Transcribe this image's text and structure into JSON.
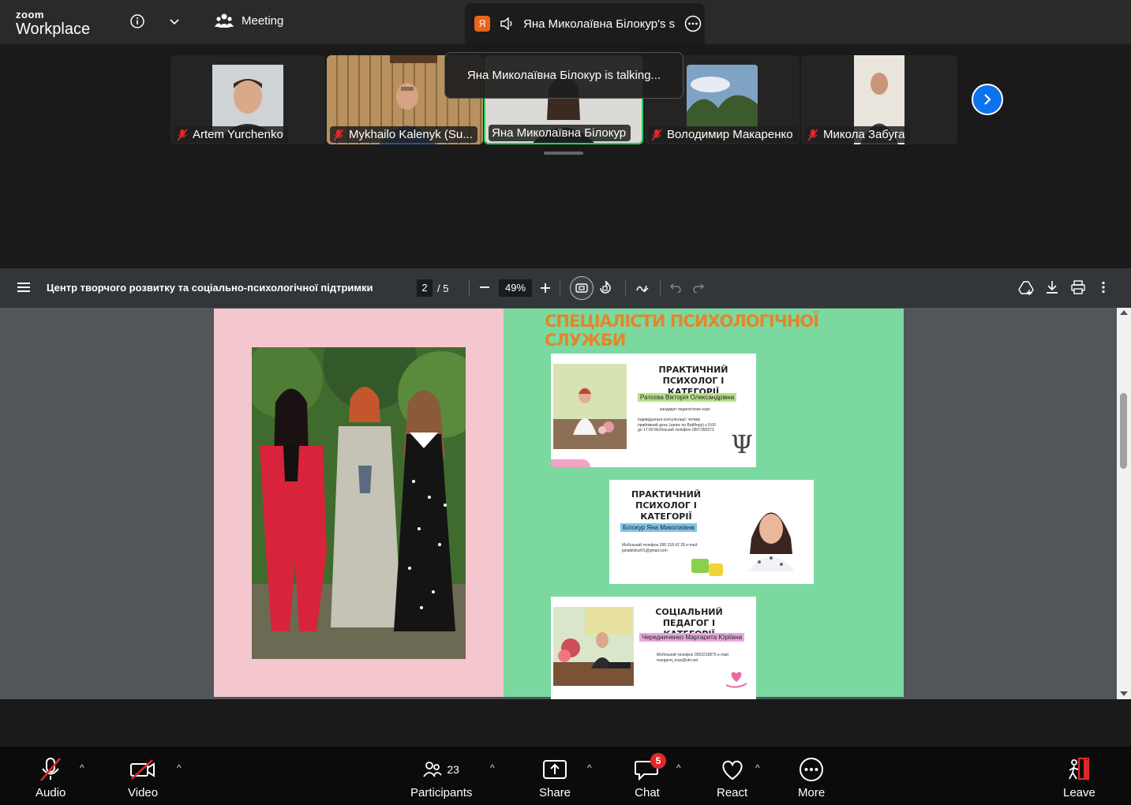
{
  "app": {
    "brand_top": "zoom",
    "brand_bottom": "Workplace"
  },
  "header": {
    "meeting_label": "Meeting",
    "speaker_tab_badge": "Я",
    "speaker_tab_title": "Яна Миколаївна Білокур's s"
  },
  "participants_strip": {
    "talking_tooltip": "Яна Миколаївна Білокур is talking...",
    "tiles": [
      {
        "name": "Artem Yurchenko",
        "muted": true
      },
      {
        "name": "Mykhailo Kalenyk (Su...",
        "muted": true
      },
      {
        "name": "Яна Миколаївна Білокур",
        "muted": false,
        "active": true
      },
      {
        "name": "Володимир Макаренко",
        "muted": true
      },
      {
        "name": "Микола Забуга",
        "muted": true
      }
    ]
  },
  "pdf": {
    "title": "Центр творчого розвитку та соціально-психологічної підтримки",
    "page_current": "2",
    "page_total": "/ 5",
    "zoom": "49%",
    "slide": {
      "heading": "СПЕЦІАЛІСТИ ПСИХОЛОГІЧНОЇ СЛУЖБИ",
      "card1": {
        "title": "ПРАКТИЧНИЙ ПСИХОЛОГ І КАТЕГОРІЇ",
        "name": "Ратєєва Вікторія Олександрівна",
        "degree": "кандидат педагогічних наук",
        "info": "Індивідуальні консультації: четвер прийомний день (запис по Вайберу) з 9:00 до 17:00 Мобільний телефон 0507350373"
      },
      "card2": {
        "title": "ПРАКТИЧНИЙ ПСИХОЛОГ І КАТЕГОРІЇ",
        "name": "Білокур Яна Миколаївна",
        "info": "Мобільний телефон 095 318 42 28 e-mail: janabilokur01@gmail.com"
      },
      "card3": {
        "title": "СОЦІАЛЬНИЙ ПЕДАГОГ І КАТЕГОРІЇ",
        "name": "Чередниченко Маргарита Юріївна",
        "info": "Мобільний телефон 0553216875 e-mail: margaret_max@ukr.net"
      }
    }
  },
  "controls": {
    "audio": "Audio",
    "video": "Video",
    "participants": "Participants",
    "participants_count": "23",
    "share": "Share",
    "chat": "Chat",
    "chat_badge": "5",
    "react": "React",
    "more": "More",
    "leave": "Leave"
  },
  "colors": {
    "accent_blue": "#0e72ed",
    "active_border": "#23d160",
    "leave_red": "#e02828",
    "slide_pink": "#f4c7cf",
    "slide_green": "#7bd9a0",
    "heading_orange": "#e3862b"
  }
}
